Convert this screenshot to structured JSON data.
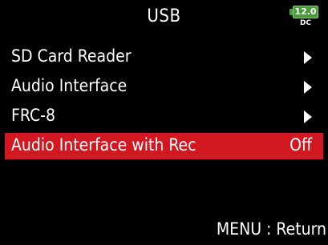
{
  "header": {
    "title": "USB",
    "battery": {
      "voltage": "12.0",
      "source": "DC",
      "color": "#4a9a3a"
    }
  },
  "menu": {
    "items": [
      {
        "label": "SD Card Reader",
        "indicator": "arrow"
      },
      {
        "label": "Audio Interface",
        "indicator": "arrow"
      },
      {
        "label": "FRC-8",
        "indicator": "arrow"
      },
      {
        "label": "Audio Interface with Rec",
        "value": "Off",
        "selected": true
      }
    ],
    "selection_color": "#d11820"
  },
  "footer": {
    "hint": "MENU : Return"
  }
}
